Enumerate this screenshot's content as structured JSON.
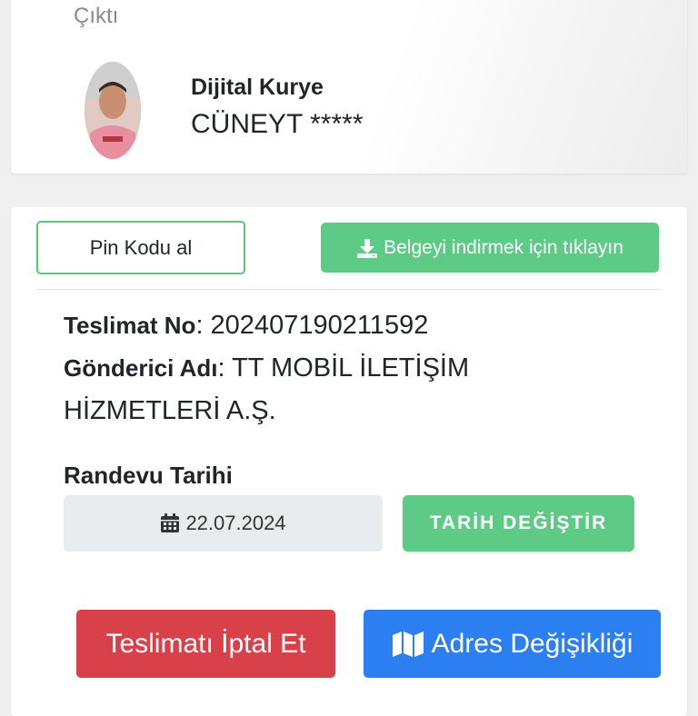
{
  "header": {
    "status_text": "Çıktı",
    "courier_title": "Dijital Kurye",
    "courier_name": "CÜNEYT *****",
    "avatar_icon": "courier-photo"
  },
  "actions": {
    "pin_label": "Pin Kodu al",
    "download_label": "Belgeyi indirmek için tıklayın",
    "download_icon": "download-icon"
  },
  "details": {
    "delivery_no_label": "Teslimat No",
    "delivery_no_value": ": 202407190211592",
    "sender_label": "Gönderici Adı",
    "sender_value": ": TT MOBİL İLETİŞİM HİZMETLERİ A.Ş."
  },
  "appointment": {
    "label": "Randevu Tarihi",
    "date": "22.07.2024",
    "date_icon": "calendar-icon",
    "change_label": "TARİH DEĞİŞTİR"
  },
  "footer": {
    "cancel_label": "Teslimatı İptal Et",
    "address_label": "Adres Değişikliği",
    "address_icon": "map-icon"
  },
  "colors": {
    "green": "#5dcb85",
    "red": "#d9414a",
    "blue": "#2c7ff0",
    "date_bg": "#e9ecef"
  }
}
